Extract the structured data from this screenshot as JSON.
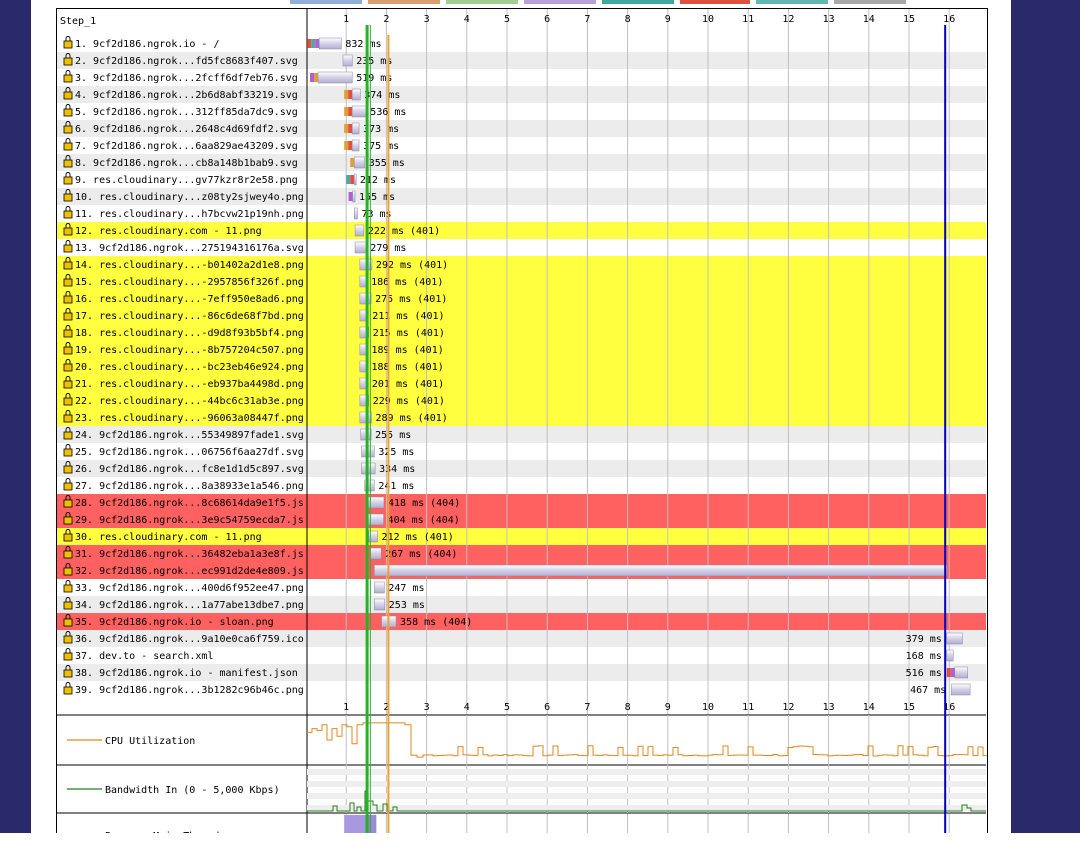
{
  "step_label": "Step_1",
  "time_axis": {
    "ticks": [
      "1",
      "2",
      "3",
      "4",
      "5",
      "6",
      "7",
      "8",
      "9",
      "10",
      "11",
      "12",
      "13",
      "14",
      "15",
      "16"
    ]
  },
  "colors": {
    "highlight_401": "#ffff40",
    "highlight_404": "#ff6060",
    "row_alt": "#ececec",
    "grid": "#c0c0c0",
    "green_marker": "#28b028",
    "orange_marker": "#f0a030",
    "blue_marker": "#0000c0",
    "bar_base": "#c9c3dc",
    "cpu_line": "#e08a1e",
    "bandwidth_line": "#208020",
    "side_panel": "#2a2a6a"
  },
  "requests": [
    {
      "label": "1. 9cf2d186.ngrok.io - /",
      "timing": "832 ms",
      "status": ""
    },
    {
      "label": "2. 9cf2d186.ngrok...fd5fc8683f407.svg",
      "timing": "235 ms",
      "status": ""
    },
    {
      "label": "3. 9cf2d186.ngrok...2fcff6df7eb76.svg",
      "timing": "519 ms",
      "status": ""
    },
    {
      "label": "4. 9cf2d186.ngrok...2b6d8abf33219.svg",
      "timing": "374 ms",
      "status": ""
    },
    {
      "label": "5. 9cf2d186.ngrok...312ff85da7dc9.svg",
      "timing": "536 ms",
      "status": ""
    },
    {
      "label": "6. 9cf2d186.ngrok...2648c4d69fdf2.svg",
      "timing": "373 ms",
      "status": ""
    },
    {
      "label": "7. 9cf2d186.ngrok...6aa829ae43209.svg",
      "timing": "375 ms",
      "status": ""
    },
    {
      "label": "8. 9cf2d186.ngrok...cb8a148b1bab9.svg",
      "timing": "355 ms",
      "status": ""
    },
    {
      "label": "9. res.cloudinary...gv77kzr8r2e58.png",
      "timing": "212 ms",
      "status": ""
    },
    {
      "label": "10. res.cloudinary...z08ty2sjwey4o.png",
      "timing": "155 ms",
      "status": ""
    },
    {
      "label": "11. res.cloudinary...h7bcvw21p19nh.png",
      "timing": "73 ms",
      "status": ""
    },
    {
      "label": "12. res.cloudinary.com - 11.png",
      "timing": "222 ms (401)",
      "status": "401"
    },
    {
      "label": "13. 9cf2d186.ngrok...275194316176a.svg",
      "timing": "279 ms",
      "status": ""
    },
    {
      "label": "14. res.cloudinary...-b01402a2d1e8.png",
      "timing": "292 ms (401)",
      "status": "401"
    },
    {
      "label": "15. res.cloudinary...-2957856f326f.png",
      "timing": "186 ms (401)",
      "status": "401"
    },
    {
      "label": "16. res.cloudinary...-7eff950e8ad6.png",
      "timing": "275 ms (401)",
      "status": "401"
    },
    {
      "label": "17. res.cloudinary...-86c6de68f7bd.png",
      "timing": "211 ms (401)",
      "status": "401"
    },
    {
      "label": "18. res.cloudinary...-d9d8f93b5bf4.png",
      "timing": "215 ms (401)",
      "status": "401"
    },
    {
      "label": "19. res.cloudinary...-8b757204c507.png",
      "timing": "189 ms (401)",
      "status": "401"
    },
    {
      "label": "20. res.cloudinary...-bc23eb46e924.png",
      "timing": "188 ms (401)",
      "status": "401"
    },
    {
      "label": "21. res.cloudinary...-eb937ba4498d.png",
      "timing": "201 ms (401)",
      "status": "401"
    },
    {
      "label": "22. res.cloudinary...-44bc6c31ab3e.png",
      "timing": "229 ms (401)",
      "status": "401"
    },
    {
      "label": "23. res.cloudinary...-96063a08447f.png",
      "timing": "289 ms (401)",
      "status": "401"
    },
    {
      "label": "24. 9cf2d186.ngrok...55349897fade1.svg",
      "timing": "255 ms",
      "status": ""
    },
    {
      "label": "25. 9cf2d186.ngrok...06756f6aa27df.svg",
      "timing": "325 ms",
      "status": ""
    },
    {
      "label": "26. 9cf2d186.ngrok...fc8e1d1d5c897.svg",
      "timing": "334 ms",
      "status": ""
    },
    {
      "label": "27. 9cf2d186.ngrok...8a38933e1a546.png",
      "timing": "241 ms",
      "status": ""
    },
    {
      "label": "28. 9cf2d186.ngrok...8c68614da9e1f5.js",
      "timing": "418 ms (404)",
      "status": "404"
    },
    {
      "label": "29. 9cf2d186.ngrok...3e9c54759ecda7.js",
      "timing": "404 ms (404)",
      "status": "404"
    },
    {
      "label": "30. res.cloudinary.com - 11.png",
      "timing": "212 ms (401)",
      "status": "401"
    },
    {
      "label": "31. 9cf2d186.ngrok...36482eba1a3e8f.js",
      "timing": "267 ms (404)",
      "status": "404"
    },
    {
      "label": "32. 9cf2d186.ngrok...ec991d2de4e809.js",
      "timing": "",
      "status": "404"
    },
    {
      "label": "33. 9cf2d186.ngrok...400d6f952ee47.png",
      "timing": "247 ms",
      "status": ""
    },
    {
      "label": "34. 9cf2d186.ngrok...1a77abe13dbe7.png",
      "timing": "253 ms",
      "status": ""
    },
    {
      "label": "35. 9cf2d186.ngrok.io - sloan.png",
      "timing": "358 ms (404)",
      "status": "404"
    },
    {
      "label": "36. 9cf2d186.ngrok...9a10e0ca6f759.ico",
      "timing": "379 ms",
      "status": ""
    },
    {
      "label": "37. dev.to - search.xml",
      "timing": "168 ms",
      "status": ""
    },
    {
      "label": "38. 9cf2d186.ngrok.io - manifest.json",
      "timing": "516 ms",
      "status": ""
    },
    {
      "label": "39. 9cf2d186.ngrok...3b1282c96b46c.png",
      "timing": "467 ms",
      "status": ""
    }
  ],
  "metrics": {
    "cpu_label": "CPU Utilization",
    "bandwidth_label": "Bandwidth In (0 - 5,000 Kbps)",
    "main_thread_label": "Browser Main Thread"
  }
}
